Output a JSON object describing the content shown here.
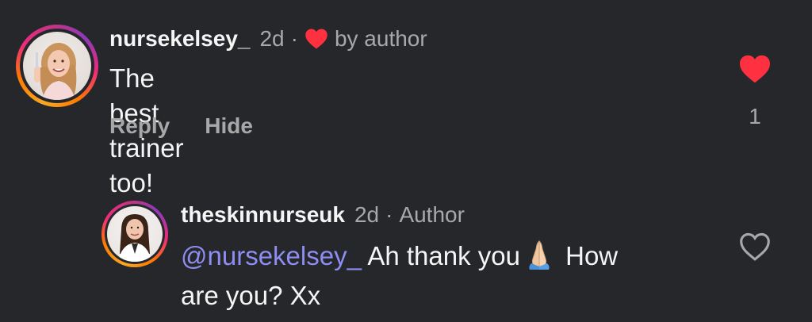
{
  "comments": [
    {
      "username": "nursekelsey_",
      "time": "2d",
      "separator": "·",
      "liked_by_label": "by author",
      "text": "The best trainer too!",
      "emoji_name": "red-heart-emoji",
      "actions": {
        "reply": "Reply",
        "hide": "Hide"
      },
      "liked": true,
      "like_count": "1"
    },
    {
      "username": "theskinnurseuk",
      "time": "2d",
      "separator": "·",
      "badge": "Author",
      "mention": "@nursekelsey_",
      "text_part1": "Ah thank you",
      "emoji_name": "folded-hands-emoji",
      "text_part2": "How",
      "text_line2": "are you? Xx",
      "liked": false
    }
  ],
  "colors": {
    "background": "#25272b",
    "like_red": "#ff3040",
    "mention_blue": "#8d8df2",
    "muted_text": "#a8a8a8"
  }
}
